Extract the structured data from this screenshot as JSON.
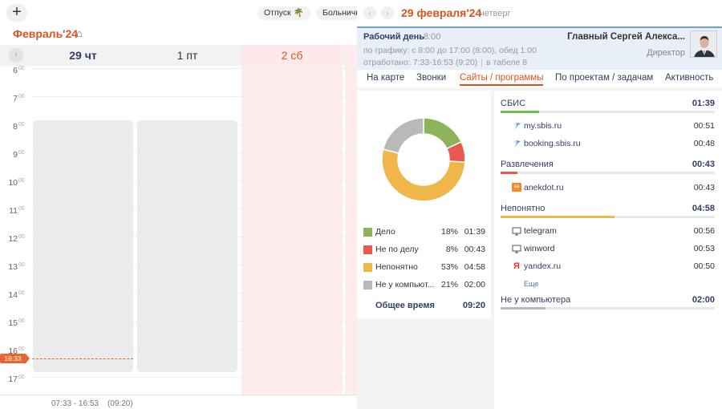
{
  "calendar": {
    "add_label": "+",
    "chips": {
      "vacation": "Отпуск",
      "sick": "Больничн"
    },
    "month": "Февраль'24",
    "days": [
      "29 чт",
      "1 пт",
      "2 сб"
    ],
    "hours": [
      "6",
      "7",
      "8",
      "9",
      "10",
      "11",
      "12",
      "13",
      "14",
      "15",
      "16",
      "17"
    ],
    "minutes": "00",
    "now_label": "16:33",
    "footer": {
      "range": "07:33 -  16:53",
      "duration": "(09:20)"
    }
  },
  "panel": {
    "date": "29 февраля'24",
    "dow": "четверг",
    "workday": {
      "title": "Рабочий день",
      "time": "8:00",
      "schedule": "по графику: с 8:00 до 17:00 (8:00), обед 1:00",
      "worked": "отработано: 7:33-16:53 (9:20)",
      "tabel": "в табеле 8"
    },
    "employee": {
      "name": "Главный Сергей Алекса...",
      "position": "Директор"
    },
    "tabs": [
      "На карте",
      "Звонки",
      "Сайты / программы",
      "По проектам / задачам",
      "Активность"
    ],
    "active_tab": "Сайты / программы",
    "legend": [
      {
        "label": "Дело",
        "pct": "18%",
        "time": "01:39",
        "color": "#8db45a"
      },
      {
        "label": "Не по делу",
        "pct": "8%",
        "time": "00:43",
        "color": "#e85a50"
      },
      {
        "label": "Непонятно",
        "pct": "53%",
        "time": "04:58",
        "color": "#efb749"
      },
      {
        "label": "Не у компьют...",
        "pct": "21%",
        "time": "02:00",
        "color": "#b9b9b9"
      }
    ],
    "total": {
      "label": "Общее время",
      "time": "09:20"
    },
    "categories": [
      {
        "name": "СБИС",
        "time": "01:39",
        "color": "#6bbf4b",
        "share": 0.18,
        "items": [
          {
            "name": "my.sbis.ru",
            "time": "00:51",
            "icon": "sbis-bird-icon"
          },
          {
            "name": "booking.sbis.ru",
            "time": "00:48",
            "icon": "sbis-bird-icon"
          }
        ]
      },
      {
        "name": "Развлечения",
        "time": "00:43",
        "color": "#e85a50",
        "share": 0.08,
        "items": [
          {
            "name": "anekdot.ru",
            "time": "00:43",
            "icon": "anekdot-icon"
          }
        ]
      },
      {
        "name": "Непонятно",
        "time": "04:58",
        "color": "#efb749",
        "share": 0.53,
        "items": [
          {
            "name": "telegram",
            "time": "00:56",
            "icon": "monitor-icon"
          },
          {
            "name": "winword",
            "time": "00:53",
            "icon": "monitor-icon"
          },
          {
            "name": "yandex.ru",
            "time": "00:50",
            "icon": "yandex-icon"
          }
        ]
      },
      {
        "name": "Не у компьютера",
        "time": "02:00",
        "color": "#b9b9b9",
        "share": 0.21,
        "items": []
      }
    ],
    "more_label": "Еще"
  },
  "chart_data": {
    "type": "pie",
    "categories": [
      "Дело",
      "Не по делу",
      "Непонятно",
      "Не у компьют..."
    ],
    "values": [
      18,
      8,
      53,
      21
    ],
    "colors": [
      "#8db45a",
      "#e85a50",
      "#efb749",
      "#b9b9b9"
    ]
  }
}
